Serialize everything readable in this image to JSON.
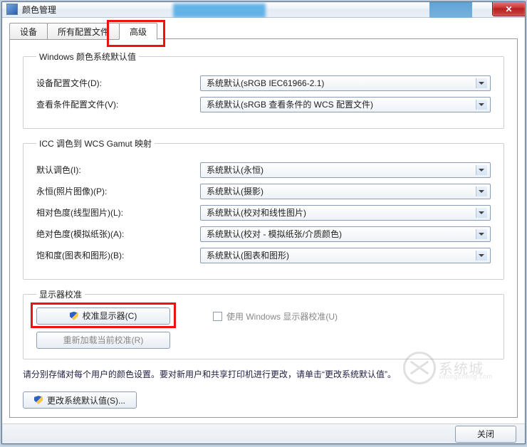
{
  "window": {
    "title": "颜色管理"
  },
  "tabs": {
    "device": "设备",
    "all_profiles": "所有配置文件",
    "advanced": "高级"
  },
  "group_defaults": {
    "legend": "Windows 颜色系统默认值",
    "device_profile_label": "设备配置文件(D):",
    "device_profile_value": "系统默认(sRGB IEC61966-2.1)",
    "viewing_label": "查看条件配置文件(V):",
    "viewing_value": "系统默认(sRGB 查看条件的 WCS 配置文件)"
  },
  "group_gamut": {
    "legend": "ICC 调色到 WCS Gamut 映射",
    "default_intent_label": "默认调色(I):",
    "default_intent_value": "系统默认(永恒)",
    "perceptual_label": "永恒(照片图像)(P):",
    "perceptual_value": "系统默认(摄影)",
    "relative_label": "相对色度(线型图片)(L):",
    "relative_value": "系统默认(校对和线性图片)",
    "absolute_label": "绝对色度(模拟纸张)(A):",
    "absolute_value": "系统默认(校对 - 模拟纸张/介质颜色)",
    "saturation_label": "饱和度(图表和图形)(B):",
    "saturation_value": "系统默认(图表和图形)"
  },
  "group_calibration": {
    "legend": "显示器校准",
    "calibrate_btn": "校准显示器(C)",
    "reload_btn": "重新加载当前校准(R)",
    "use_windows_calib": "使用 Windows 显示器校准(U)"
  },
  "hint": "请分别存储对每个用户的颜色设置。要对新用户和共享打印机进行更改，请单击“更改系统默认值”。",
  "change_defaults_btn": "更改系统默认值(S)...",
  "footer": {
    "close": "关闭"
  },
  "watermark": {
    "brand": "系统城",
    "sub": "xitongcheng.com"
  }
}
